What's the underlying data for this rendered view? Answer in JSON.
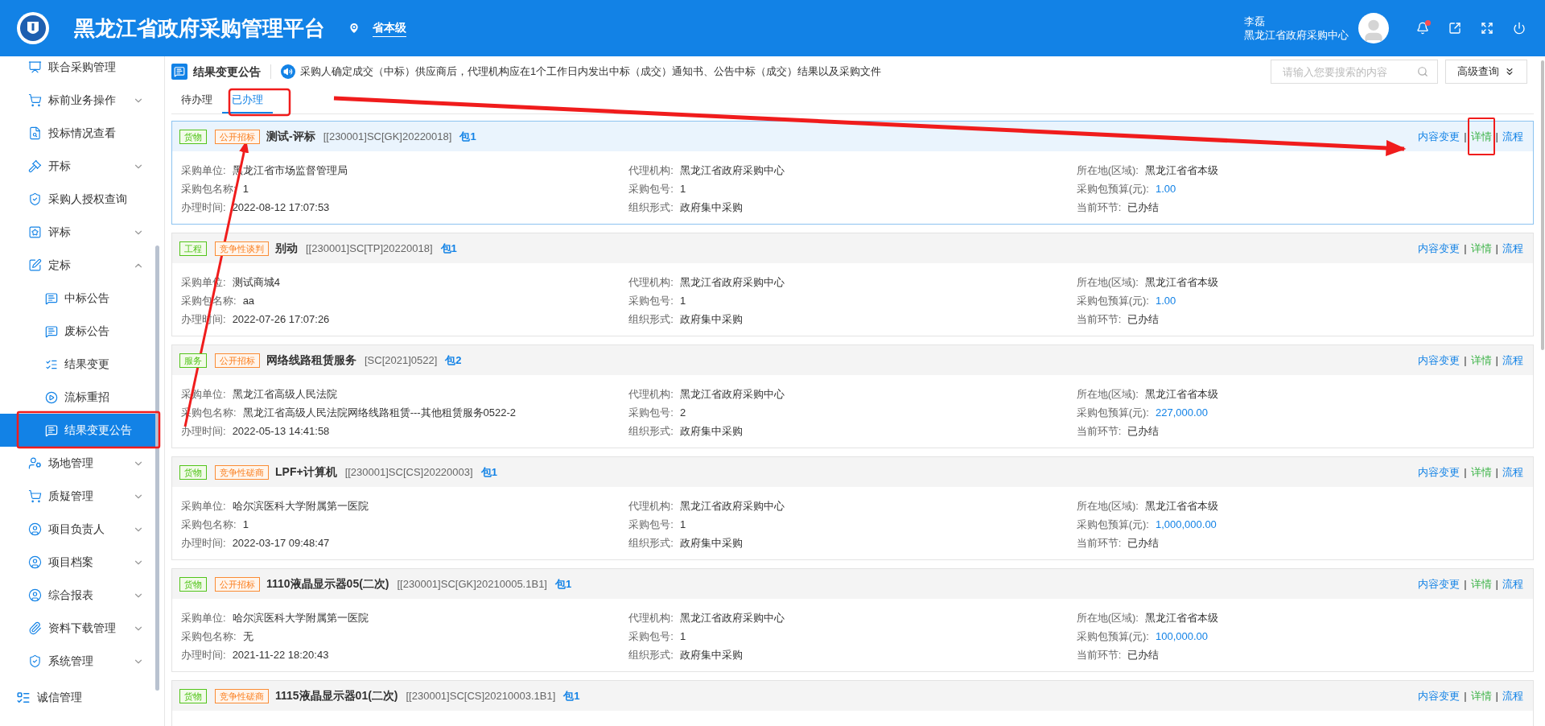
{
  "header": {
    "title": "黑龙江省政府采购管理平台",
    "location": "省本级",
    "user_name": "李磊",
    "user_org": "黑龙江省政府采购中心",
    "notification_dot": true
  },
  "sidebar": {
    "items": [
      {
        "label": "联合采购管理",
        "kind": "link",
        "selected": false
      },
      {
        "label": "标前业务操作",
        "kind": "group",
        "expanded": false,
        "selected": false
      },
      {
        "label": "投标情况查看",
        "kind": "link",
        "selected": false
      },
      {
        "label": "开标",
        "kind": "group",
        "expanded": false,
        "selected": false
      },
      {
        "label": "采购人授权查询",
        "kind": "link",
        "selected": false
      },
      {
        "label": "评标",
        "kind": "group",
        "expanded": false,
        "selected": false
      },
      {
        "label": "定标",
        "kind": "group",
        "expanded": true,
        "selected": false,
        "children": [
          {
            "label": "中标公告",
            "selected": false
          },
          {
            "label": "废标公告",
            "selected": false
          },
          {
            "label": "结果变更",
            "selected": false
          },
          {
            "label": "流标重招",
            "selected": false
          },
          {
            "label": "结果变更公告",
            "selected": true
          }
        ]
      },
      {
        "label": "场地管理",
        "kind": "group",
        "expanded": false,
        "selected": false
      },
      {
        "label": "质疑管理",
        "kind": "group",
        "expanded": false,
        "selected": false
      },
      {
        "label": "项目负责人",
        "kind": "group",
        "expanded": false,
        "selected": false
      },
      {
        "label": "项目档案",
        "kind": "group",
        "expanded": false,
        "selected": false
      },
      {
        "label": "综合报表",
        "kind": "group",
        "expanded": false,
        "selected": false
      },
      {
        "label": "资料下载管理",
        "kind": "group",
        "expanded": false,
        "selected": false
      },
      {
        "label": "系统管理",
        "kind": "group",
        "expanded": false,
        "selected": false
      }
    ],
    "footer_item": {
      "label": "诚信管理"
    }
  },
  "page": {
    "title": "结果变更公告",
    "notice": "采购人确定成交（中标）供应商后，代理机构应在1个工作日内发出中标（成交）通知书、公告中标（成交）结果以及采购文件",
    "search": {
      "placeholder": "请输入您要搜索的内容"
    },
    "advanced_button": "高级查询"
  },
  "tabs": [
    {
      "label": "待办理",
      "selected": false
    },
    {
      "label": "已办理",
      "selected": true
    }
  ],
  "cards": [
    {
      "selected": true,
      "category": "货物",
      "method": "公开招标",
      "title": "测试-评标",
      "code": "[[230001]SC[GK]20220018]",
      "package": "包1",
      "actions": [
        "内容变更",
        "详情",
        "流程"
      ],
      "separators": [
        "|",
        "|"
      ],
      "fields": [
        {
          "label": "采购单位:",
          "value": "黑龙江省市场监督管理局",
          "kind": "text"
        },
        {
          "label": "代理机构:",
          "value": "黑龙江省政府采购中心",
          "kind": "text"
        },
        {
          "label": "所在地(区域):",
          "value": "黑龙江省省本级",
          "kind": "text"
        },
        {
          "label": "采购包名称:",
          "value": "1",
          "kind": "text"
        },
        {
          "label": "采购包号:",
          "value": "1",
          "kind": "text"
        },
        {
          "label": "采购包预算(元):",
          "value": "1.00",
          "kind": "amount"
        },
        {
          "label": "办理时间:",
          "value": "2022-08-12 17:07:53",
          "kind": "text"
        },
        {
          "label": "组织形式:",
          "value": "政府集中采购",
          "kind": "text"
        },
        {
          "label": "当前环节:",
          "value": "已办结",
          "kind": "text"
        }
      ]
    },
    {
      "selected": false,
      "category": "工程",
      "method": "竞争性谈判",
      "title": "别动",
      "code": "[[230001]SC[TP]20220018]",
      "package": "包1",
      "actions": [
        "内容变更",
        "详情",
        "流程"
      ],
      "separators": [
        "|",
        "|"
      ],
      "fields": [
        {
          "label": "采购单位:",
          "value": "测试商城4",
          "kind": "text"
        },
        {
          "label": "代理机构:",
          "value": "黑龙江省政府采购中心",
          "kind": "text"
        },
        {
          "label": "所在地(区域):",
          "value": "黑龙江省省本级",
          "kind": "text"
        },
        {
          "label": "采购包名称:",
          "value": "aa",
          "kind": "text"
        },
        {
          "label": "采购包号:",
          "value": "1",
          "kind": "text"
        },
        {
          "label": "采购包预算(元):",
          "value": "1.00",
          "kind": "amount"
        },
        {
          "label": "办理时间:",
          "value": "2022-07-26 17:07:26",
          "kind": "text"
        },
        {
          "label": "组织形式:",
          "value": "政府集中采购",
          "kind": "text"
        },
        {
          "label": "当前环节:",
          "value": "已办结",
          "kind": "text"
        }
      ]
    },
    {
      "selected": false,
      "category": "服务",
      "method": "公开招标",
      "title": "网络线路租赁服务",
      "code": "[SC[2021]0522]",
      "package": "包2",
      "actions": [
        "内容变更",
        "详情",
        "流程"
      ],
      "separators": [
        "|",
        "|"
      ],
      "fields": [
        {
          "label": "采购单位:",
          "value": "黑龙江省高级人民法院",
          "kind": "text"
        },
        {
          "label": "代理机构:",
          "value": "黑龙江省政府采购中心",
          "kind": "text"
        },
        {
          "label": "所在地(区域):",
          "value": "黑龙江省省本级",
          "kind": "text"
        },
        {
          "label": "采购包名称:",
          "value": "黑龙江省高级人民法院网络线路租赁---其他租赁服务0522-2",
          "kind": "text"
        },
        {
          "label": "采购包号:",
          "value": "2",
          "kind": "text"
        },
        {
          "label": "采购包预算(元):",
          "value": "227,000.00",
          "kind": "amount"
        },
        {
          "label": "办理时间:",
          "value": "2022-05-13 14:41:58",
          "kind": "text"
        },
        {
          "label": "组织形式:",
          "value": "政府集中采购",
          "kind": "text"
        },
        {
          "label": "当前环节:",
          "value": "已办结",
          "kind": "text"
        }
      ]
    },
    {
      "selected": false,
      "category": "货物",
      "method": "竞争性磋商",
      "title": "LPF+计算机",
      "code": "[[230001]SC[CS]20220003]",
      "package": "包1",
      "actions": [
        "内容变更",
        "详情",
        "流程"
      ],
      "separators": [
        "|",
        "|"
      ],
      "fields": [
        {
          "label": "采购单位:",
          "value": "哈尔滨医科大学附属第一医院",
          "kind": "text"
        },
        {
          "label": "代理机构:",
          "value": "黑龙江省政府采购中心",
          "kind": "text"
        },
        {
          "label": "所在地(区域):",
          "value": "黑龙江省省本级",
          "kind": "text"
        },
        {
          "label": "采购包名称:",
          "value": "1",
          "kind": "text"
        },
        {
          "label": "采购包号:",
          "value": "1",
          "kind": "text"
        },
        {
          "label": "采购包预算(元):",
          "value": "1,000,000.00",
          "kind": "amount"
        },
        {
          "label": "办理时间:",
          "value": "2022-03-17 09:48:47",
          "kind": "text"
        },
        {
          "label": "组织形式:",
          "value": "政府集中采购",
          "kind": "text"
        },
        {
          "label": "当前环节:",
          "value": "已办结",
          "kind": "text"
        }
      ]
    },
    {
      "selected": false,
      "category": "货物",
      "method": "公开招标",
      "title": "1110液晶显示器05(二次)",
      "code": "[[230001]SC[GK]20210005.1B1]",
      "package": "包1",
      "actions": [
        "内容变更",
        "详情",
        "流程"
      ],
      "separators": [
        "|",
        "|"
      ],
      "fields": [
        {
          "label": "采购单位:",
          "value": "哈尔滨医科大学附属第一医院",
          "kind": "text"
        },
        {
          "label": "代理机构:",
          "value": "黑龙江省政府采购中心",
          "kind": "text"
        },
        {
          "label": "所在地(区域):",
          "value": "黑龙江省省本级",
          "kind": "text"
        },
        {
          "label": "采购包名称:",
          "value": "无",
          "kind": "text"
        },
        {
          "label": "采购包号:",
          "value": "1",
          "kind": "text"
        },
        {
          "label": "采购包预算(元):",
          "value": "100,000.00",
          "kind": "amount"
        },
        {
          "label": "办理时间:",
          "value": "2021-11-22 18:20:43",
          "kind": "text"
        },
        {
          "label": "组织形式:",
          "value": "政府集中采购",
          "kind": "text"
        },
        {
          "label": "当前环节:",
          "value": "已办结",
          "kind": "text"
        }
      ]
    },
    {
      "selected": false,
      "category": "货物",
      "method": "竞争性磋商",
      "title": "1115液晶显示器01(二次)",
      "code": "[[230001]SC[CS]20210003.1B1]",
      "package": "包1",
      "actions": [
        "内容变更",
        "详情",
        "流程"
      ],
      "separators": [
        "|",
        "|"
      ]
    }
  ]
}
